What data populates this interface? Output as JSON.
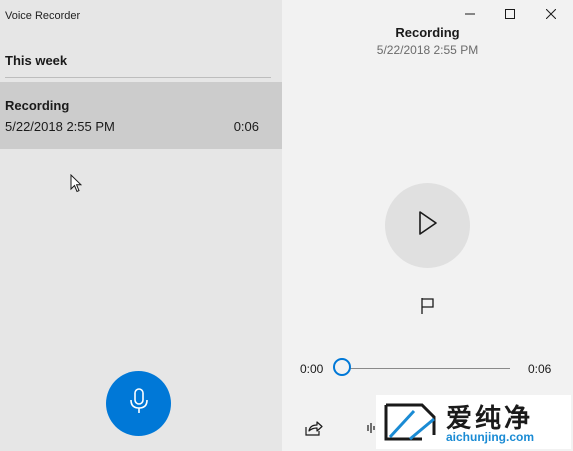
{
  "app": {
    "title": "Voice Recorder"
  },
  "list": {
    "section_header": "This week",
    "items": [
      {
        "title": "Recording",
        "date": "5/22/2018 2:55 PM",
        "duration": "0:06",
        "selected": true
      }
    ]
  },
  "detail": {
    "title": "Recording",
    "date": "5/22/2018 2:55 PM"
  },
  "player": {
    "current_time": "0:00",
    "total_time": "0:06",
    "progress_fraction": 0
  },
  "watermark": {
    "text": "爱纯净",
    "url": "aichunjing.com"
  },
  "colors": {
    "accent": "#0078d7",
    "left_pane_bg": "#e6e6e6",
    "right_pane_bg": "#f2f2f2",
    "selected_item_bg": "#cccccc"
  },
  "icons": {
    "record": "microphone-icon",
    "play": "play-icon",
    "flag": "flag-icon",
    "share": "share-icon",
    "trim": "trim-icon",
    "minimize": "minimize-icon",
    "maximize": "maximize-icon",
    "close": "close-icon"
  }
}
